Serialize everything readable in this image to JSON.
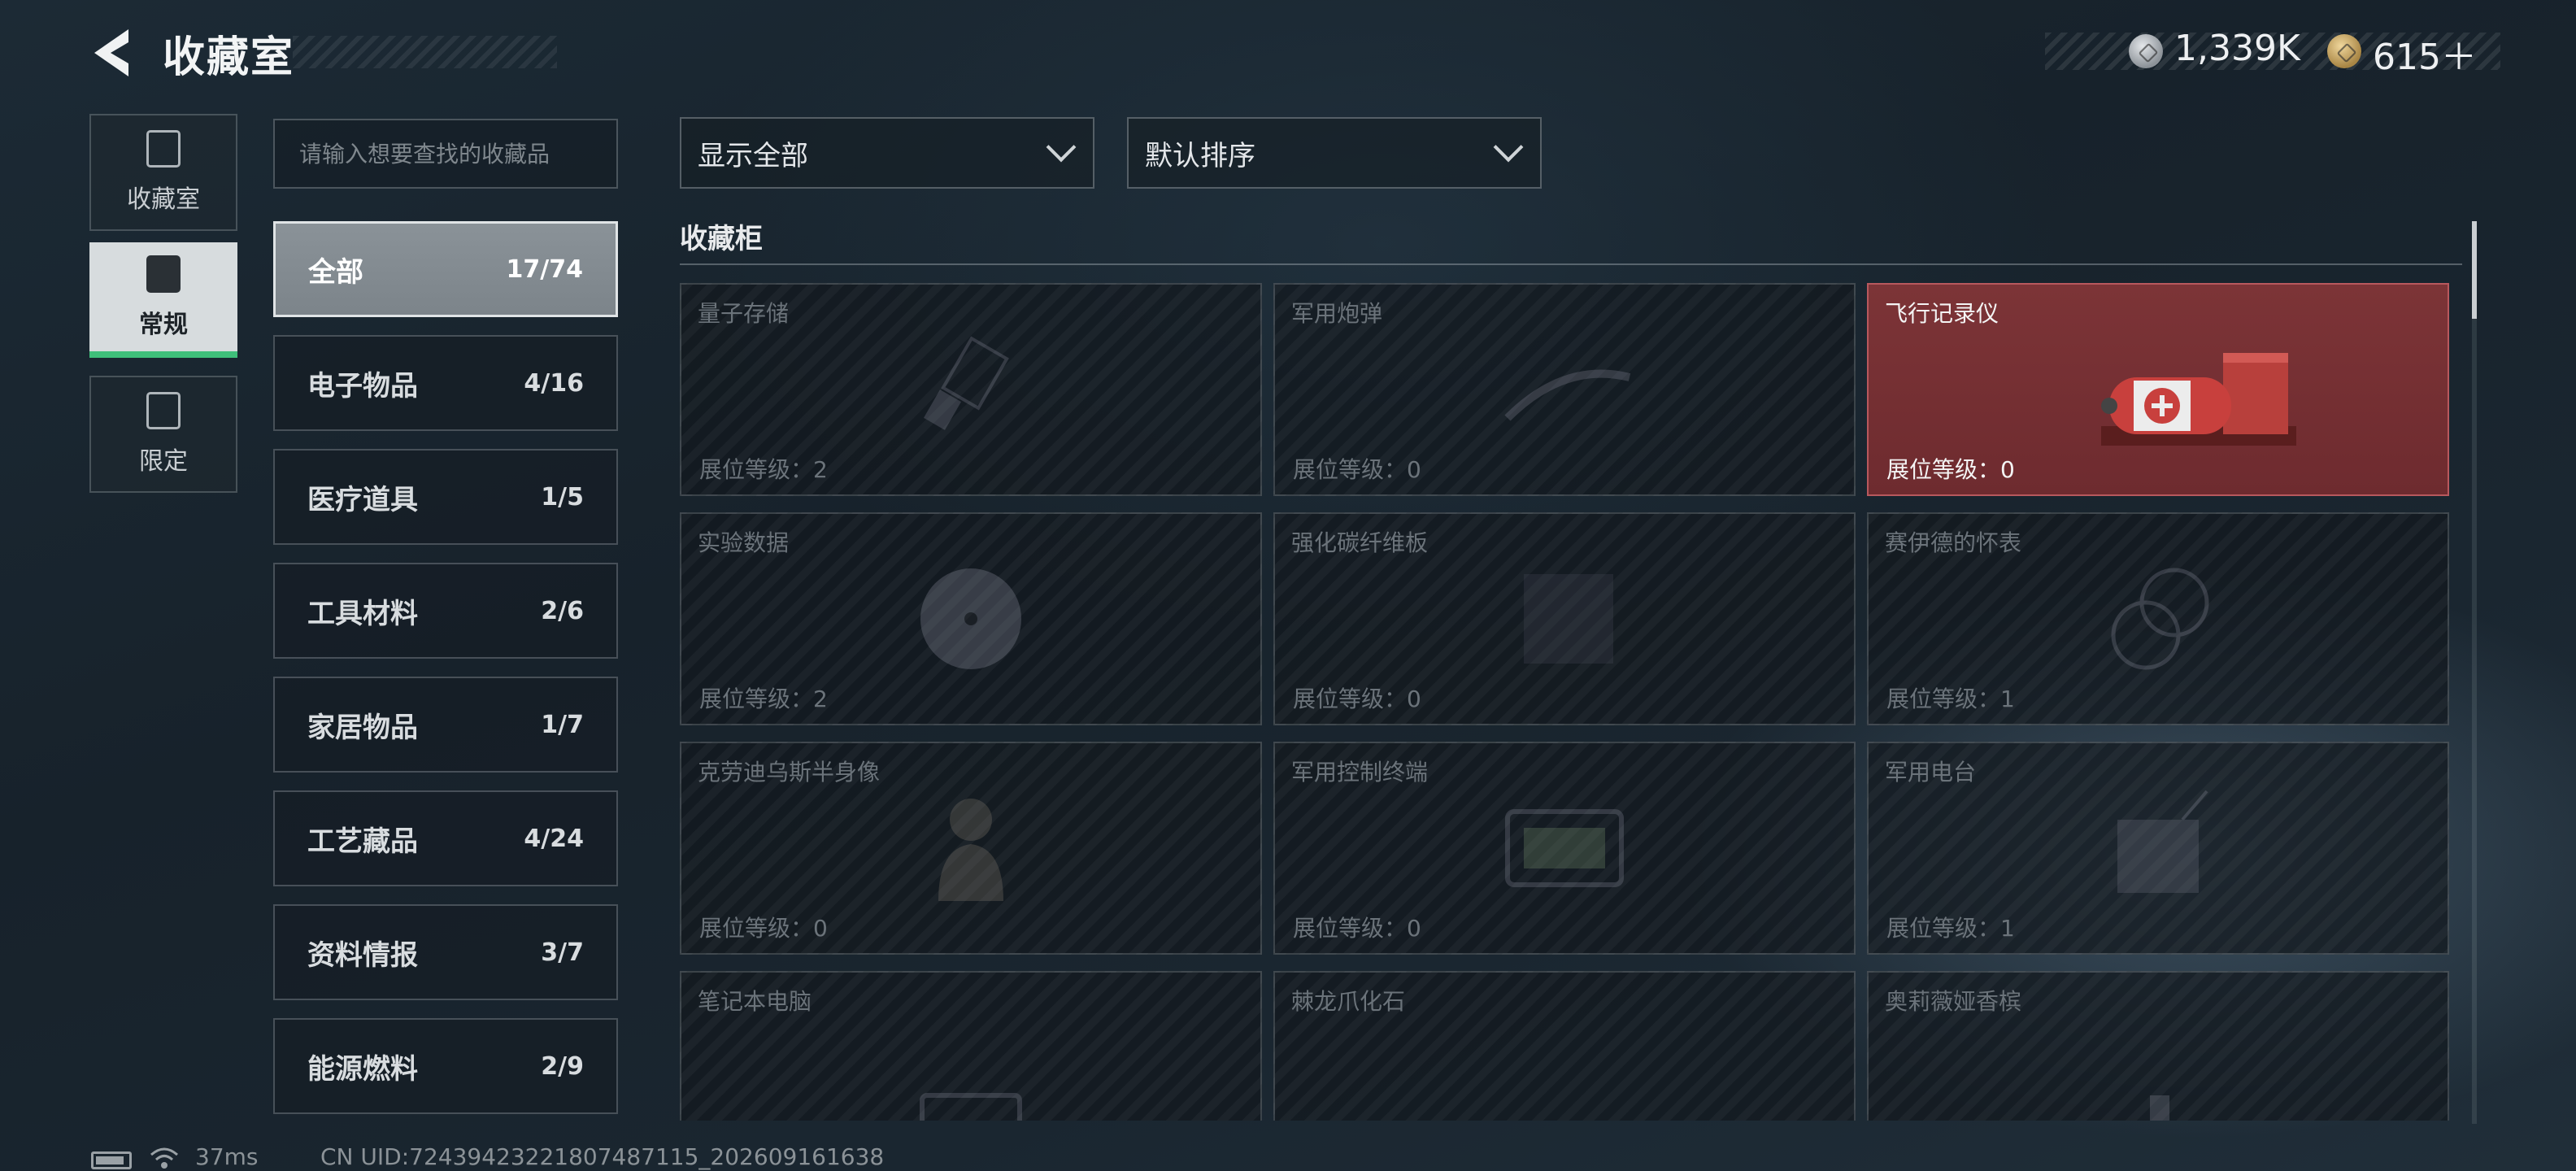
{
  "header": {
    "title": "收藏室",
    "currency": [
      {
        "icon": "silver-coin-icon",
        "value": "1,339K"
      },
      {
        "icon": "gold-coin-icon",
        "value": "615＋"
      }
    ]
  },
  "nav": {
    "tabs": [
      {
        "label": "收藏室",
        "icon": "collection-room-icon",
        "active": false
      },
      {
        "label": "常规",
        "icon": "regular-icon",
        "active": true
      },
      {
        "label": "限定",
        "icon": "limited-icon",
        "active": false
      }
    ]
  },
  "search": {
    "placeholder": "请输入想要查找的收藏品"
  },
  "categories": [
    {
      "name": "全部",
      "count": "17/74",
      "active": true
    },
    {
      "name": "电子物品",
      "count": "4/16"
    },
    {
      "name": "医疗道具",
      "count": "1/5"
    },
    {
      "name": "工具材料",
      "count": "2/6"
    },
    {
      "name": "家居物品",
      "count": "1/7"
    },
    {
      "name": "工艺藏品",
      "count": "4/24"
    },
    {
      "name": "资料情报",
      "count": "3/7"
    },
    {
      "name": "能源燃料",
      "count": "2/9"
    }
  ],
  "filters": {
    "display": "显示全部",
    "sort": "默认排序"
  },
  "section": {
    "title": "收藏柜"
  },
  "cards": [
    {
      "name": "量子存储",
      "level": "展位等级：2",
      "unlocked": false
    },
    {
      "name": "军用炮弹",
      "level": "展位等级：0",
      "unlocked": false
    },
    {
      "name": "飞行记录仪",
      "level": "展位等级：0",
      "unlocked": true
    },
    {
      "name": "实验数据",
      "level": "展位等级：2",
      "unlocked": false
    },
    {
      "name": "强化碳纤维板",
      "level": "展位等级：0",
      "unlocked": false
    },
    {
      "name": "赛伊德的怀表",
      "level": "展位等级：1",
      "unlocked": false
    },
    {
      "name": "克劳迪乌斯半身像",
      "level": "展位等级：0",
      "unlocked": false
    },
    {
      "name": "军用控制终端",
      "level": "展位等级：0",
      "unlocked": false
    },
    {
      "name": "军用电台",
      "level": "展位等级：1",
      "unlocked": false
    },
    {
      "name": "笔记本电脑",
      "level": "",
      "unlocked": false
    },
    {
      "name": "棘龙爪化石",
      "level": "",
      "unlocked": false
    },
    {
      "name": "奥莉薇娅香槟",
      "level": "",
      "unlocked": false
    }
  ],
  "footer": {
    "ping": "37ms",
    "uid": "CN UID:7243942322180748711​5_202609161638"
  }
}
